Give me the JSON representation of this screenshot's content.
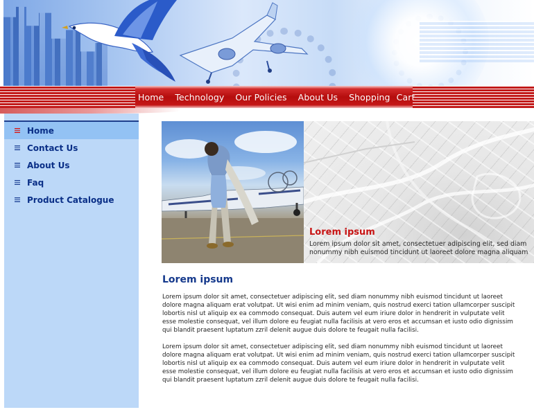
{
  "nav": {
    "items": [
      "Home",
      "Technology",
      "Our Policies",
      "About Us",
      "Shopping  Cart"
    ]
  },
  "sidebar": {
    "items": [
      {
        "label": "Home",
        "active": true
      },
      {
        "label": "Contact Us",
        "active": false
      },
      {
        "label": "About Us",
        "active": false
      },
      {
        "label": "Faq",
        "active": false
      },
      {
        "label": "Product Catalogue",
        "active": false
      }
    ]
  },
  "feature": {
    "title": "Lorem ipsum",
    "text": "Lorem ipsum dolor sit amet, consectetuer adipiscing elit, sed diam nonummy nibh euismod tincidunt ut laoreet dolore magna aliquam"
  },
  "main": {
    "title": "Lorem ipsum",
    "paragraphs": [
      "Lorem ipsum dolor sit amet, consectetuer adipiscing elit, sed diam nonummy nibh euismod tincidunt ut laoreet dolore magna aliquam erat volutpat. Ut wisi enim ad minim veniam, quis nostrud exerci tation ullamcorper suscipit lobortis nisl ut aliquip ex ea commodo consequat. Duis autem vel eum iriure dolor in hendrerit in vulputate velit esse molestie consequat, vel illum dolore eu feugiat nulla facilisis at vero eros et accumsan et iusto odio dignissim qui blandit praesent luptatum zzril delenit augue duis dolore te feugait nulla facilisi.",
      "Lorem ipsum dolor sit amet, consectetuer adipiscing elit, sed diam nonummy nibh euismod tincidunt ut laoreet dolore magna aliquam erat volutpat. Ut wisi enim ad minim veniam, quis nostrud exerci tation ullamcorper suscipit lobortis nisl ut aliquip ex ea commodo consequat. Duis autem vel eum iriure dolor in hendrerit in vulputate velit esse molestie consequat, vel illum dolore eu feugiat nulla facilisis at vero eros et accumsan et iusto odio dignissim qui blandit praesent luptatum zzril delenit augue duis dolore te feugait nulla facilisi."
    ]
  },
  "colors": {
    "nav_red": "#b50d0d",
    "sidebar_bg": "#bcd8f8",
    "sidebar_active": "#93c2f4",
    "link_blue": "#0a2f87",
    "caption_red": "#c81414",
    "heading_blue": "#15398c"
  },
  "icons": {
    "sidebar_bullet": "list-bullet-icon",
    "banner_bird": "dove-icon",
    "banner_plane": "airplane-icon"
  }
}
